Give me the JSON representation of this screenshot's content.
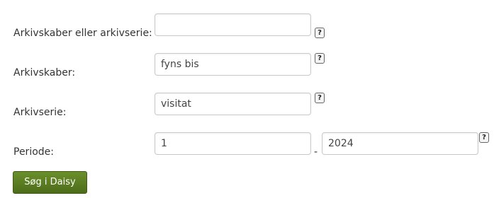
{
  "form": {
    "archive_any": {
      "label": "Arkivskaber eller arkivserie:",
      "value": "",
      "help": "?"
    },
    "creator": {
      "label": "Arkivskaber:",
      "value": "fyns bis",
      "help": "?"
    },
    "series": {
      "label": "Arkivserie:",
      "value": "visitat",
      "help": "?"
    },
    "period": {
      "label": "Periode:",
      "from": "1",
      "separator": "-",
      "to": "2024",
      "help": "?"
    },
    "submit_label": "Søg i Daisy"
  },
  "colors": {
    "button": "#5a7d22",
    "field_border": "#c9c9c9"
  }
}
